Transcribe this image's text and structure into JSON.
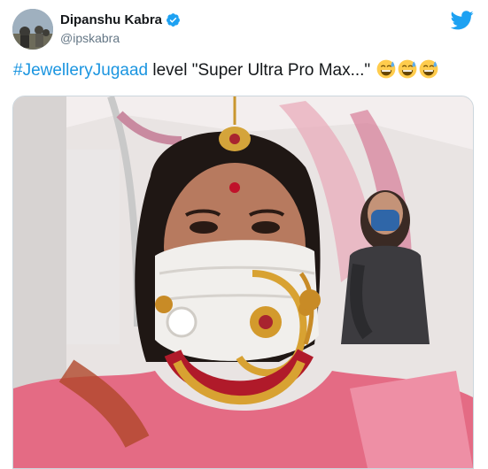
{
  "tweet": {
    "author": {
      "display_name": "Dipanshu Kabra",
      "handle": "@ipskabra",
      "verified": true,
      "avatar_icon": "profile-photo"
    },
    "platform_icon": "twitter-bird-icon",
    "text": {
      "hashtag": "#JewelleryJugaad",
      "body": " level \"Super Ultra Pro Max...\"",
      "emojis": [
        "grinning-sweat-emoji",
        "grinning-sweat-emoji",
        "grinning-sweat-emoji"
      ]
    },
    "media": {
      "description_icon": "photo-woman-nose-ring-on-mask"
    }
  },
  "colors": {
    "link": "#1b95e0",
    "verified": "#1da1f2",
    "twitter_blue": "#1da1f2",
    "secondary_text": "#657786"
  }
}
